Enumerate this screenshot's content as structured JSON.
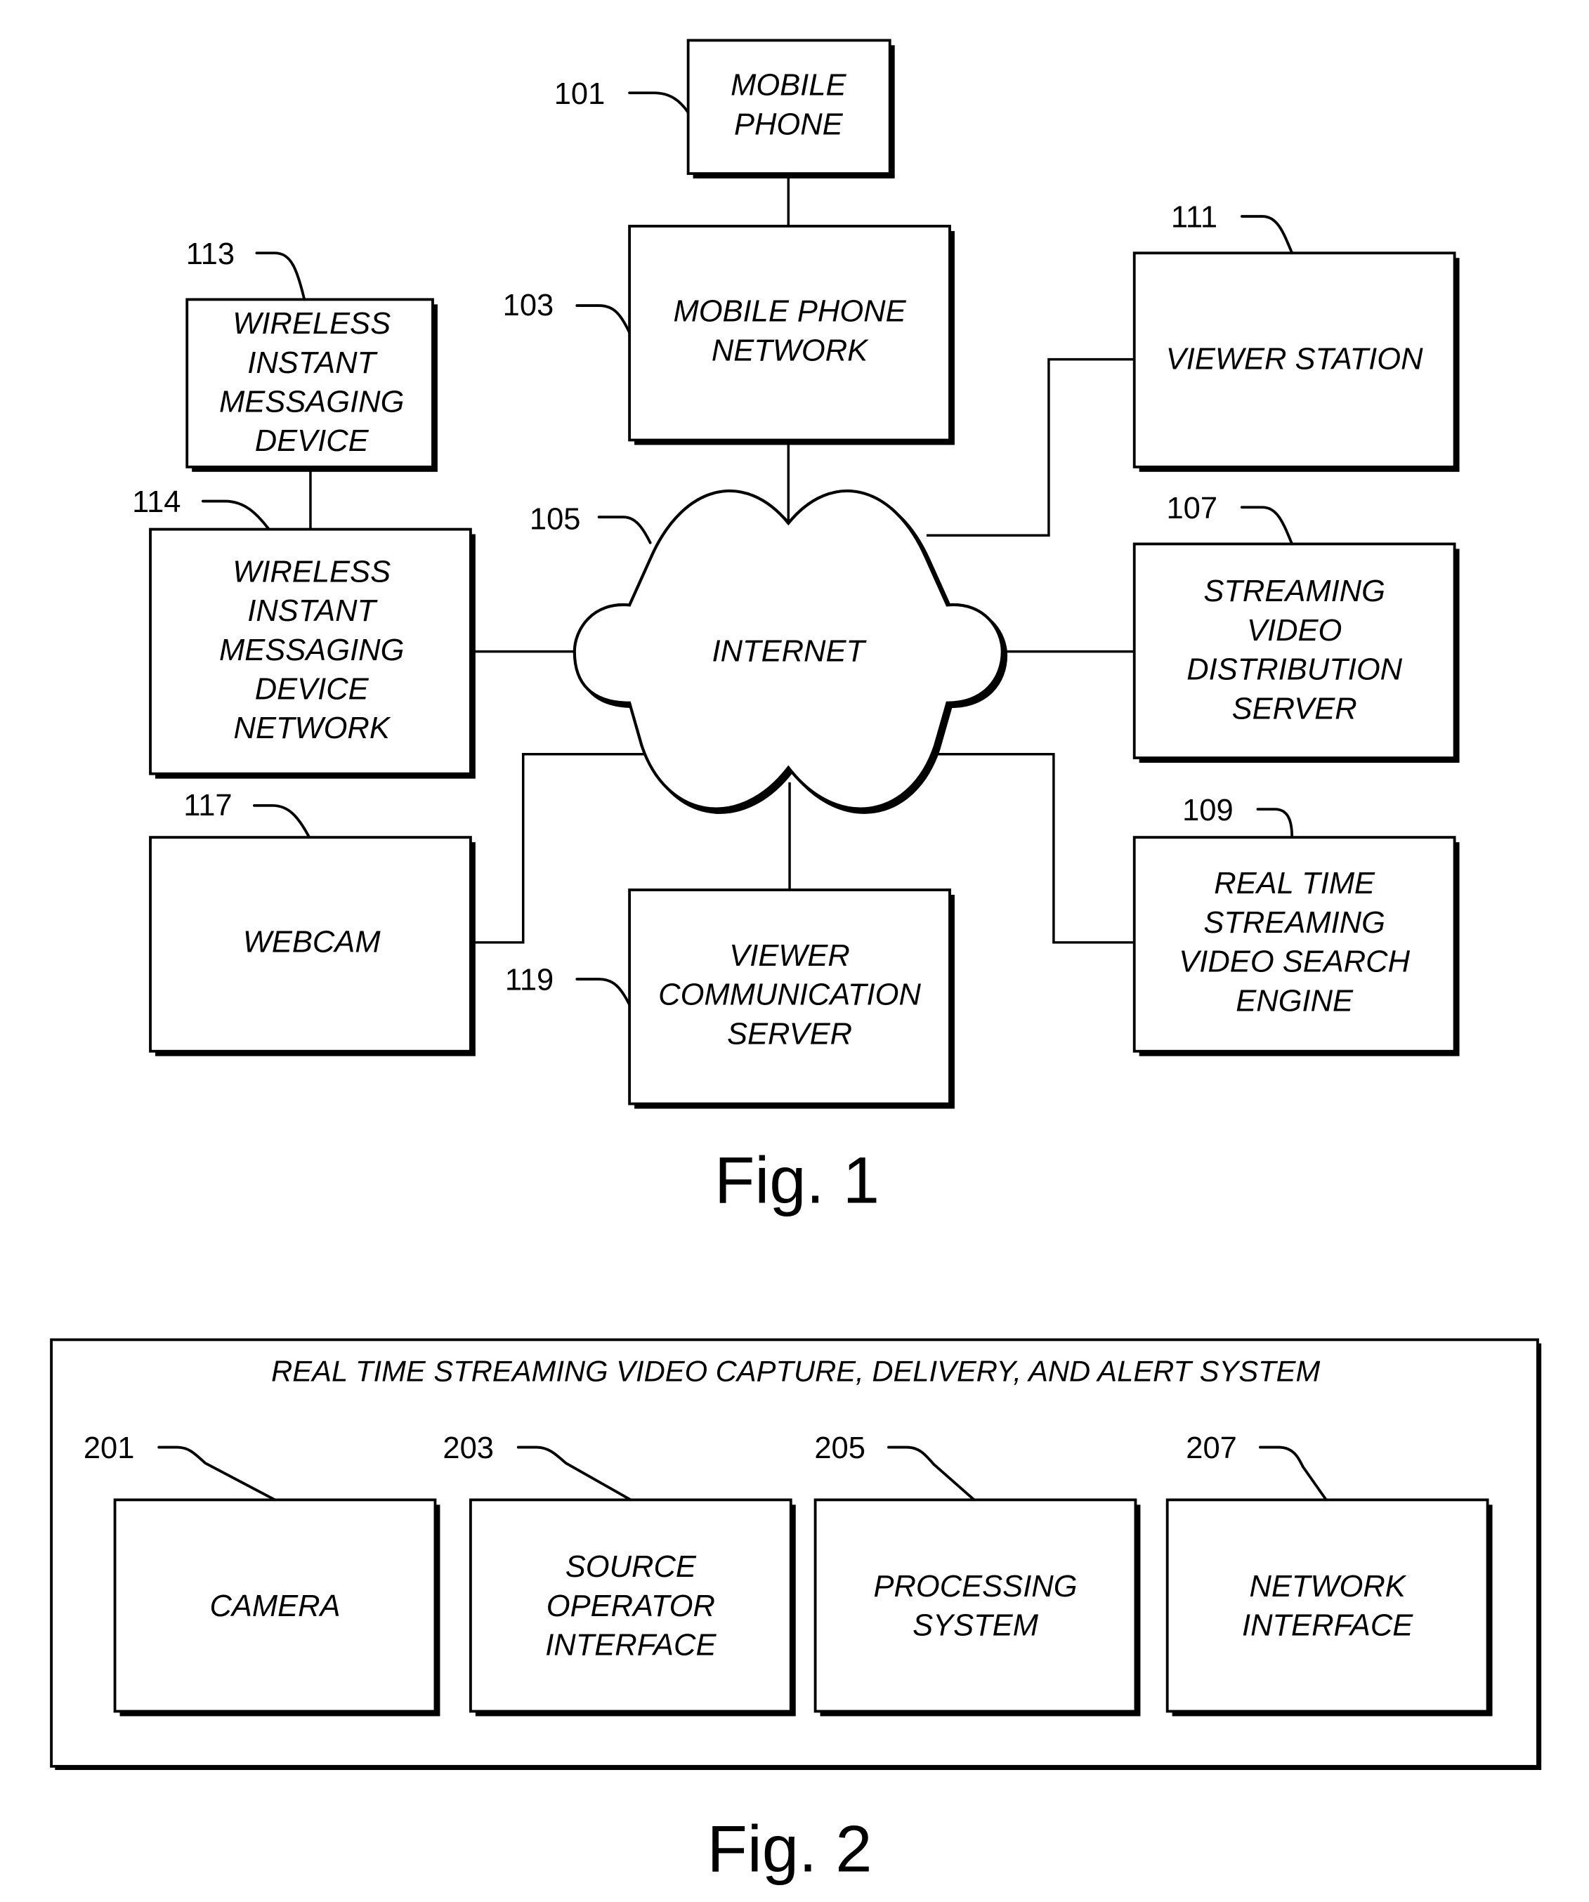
{
  "figure1": {
    "caption": "Fig. 1",
    "internet": {
      "ref": "105",
      "lines": [
        "INTERNET"
      ]
    },
    "nodes": {
      "mobile_phone": {
        "ref": "101",
        "lines": [
          "MOBILE",
          "PHONE"
        ]
      },
      "mobile_phone_network": {
        "ref": "103",
        "lines": [
          "MOBILE PHONE",
          "NETWORK"
        ]
      },
      "viewer_station": {
        "ref": "111",
        "lines": [
          "VIEWER STATION"
        ]
      },
      "streaming_video_distribution_server": {
        "ref": "107",
        "lines": [
          "STREAMING",
          "VIDEO",
          "DISTRIBUTION",
          "SERVER"
        ]
      },
      "real_time_streaming_video_search_engine": {
        "ref": "109",
        "lines": [
          "REAL TIME",
          "STREAMING",
          "VIDEO SEARCH",
          "ENGINE"
        ]
      },
      "wireless_im_device": {
        "ref": "113",
        "lines": [
          "WIRELESS",
          "INSTANT",
          "MESSAGING",
          "DEVICE"
        ]
      },
      "wireless_im_device_network": {
        "ref": "114",
        "lines": [
          "WIRELESS",
          "INSTANT",
          "MESSAGING",
          "DEVICE",
          "NETWORK"
        ]
      },
      "webcam": {
        "ref": "117",
        "lines": [
          "WEBCAM"
        ]
      },
      "viewer_communication_server": {
        "ref": "119",
        "lines": [
          "VIEWER",
          "COMMUNICATION",
          "SERVER"
        ]
      }
    }
  },
  "figure2": {
    "caption": "Fig. 2",
    "system_title": "REAL TIME STREAMING VIDEO CAPTURE, DELIVERY, AND ALERT SYSTEM",
    "components": [
      {
        "ref": "201",
        "lines": [
          "CAMERA"
        ]
      },
      {
        "ref": "203",
        "lines": [
          "SOURCE",
          "OPERATOR",
          "INTERFACE"
        ]
      },
      {
        "ref": "205",
        "lines": [
          "PROCESSING",
          "SYSTEM"
        ]
      },
      {
        "ref": "207",
        "lines": [
          "NETWORK",
          "INTERFACE"
        ]
      }
    ]
  }
}
